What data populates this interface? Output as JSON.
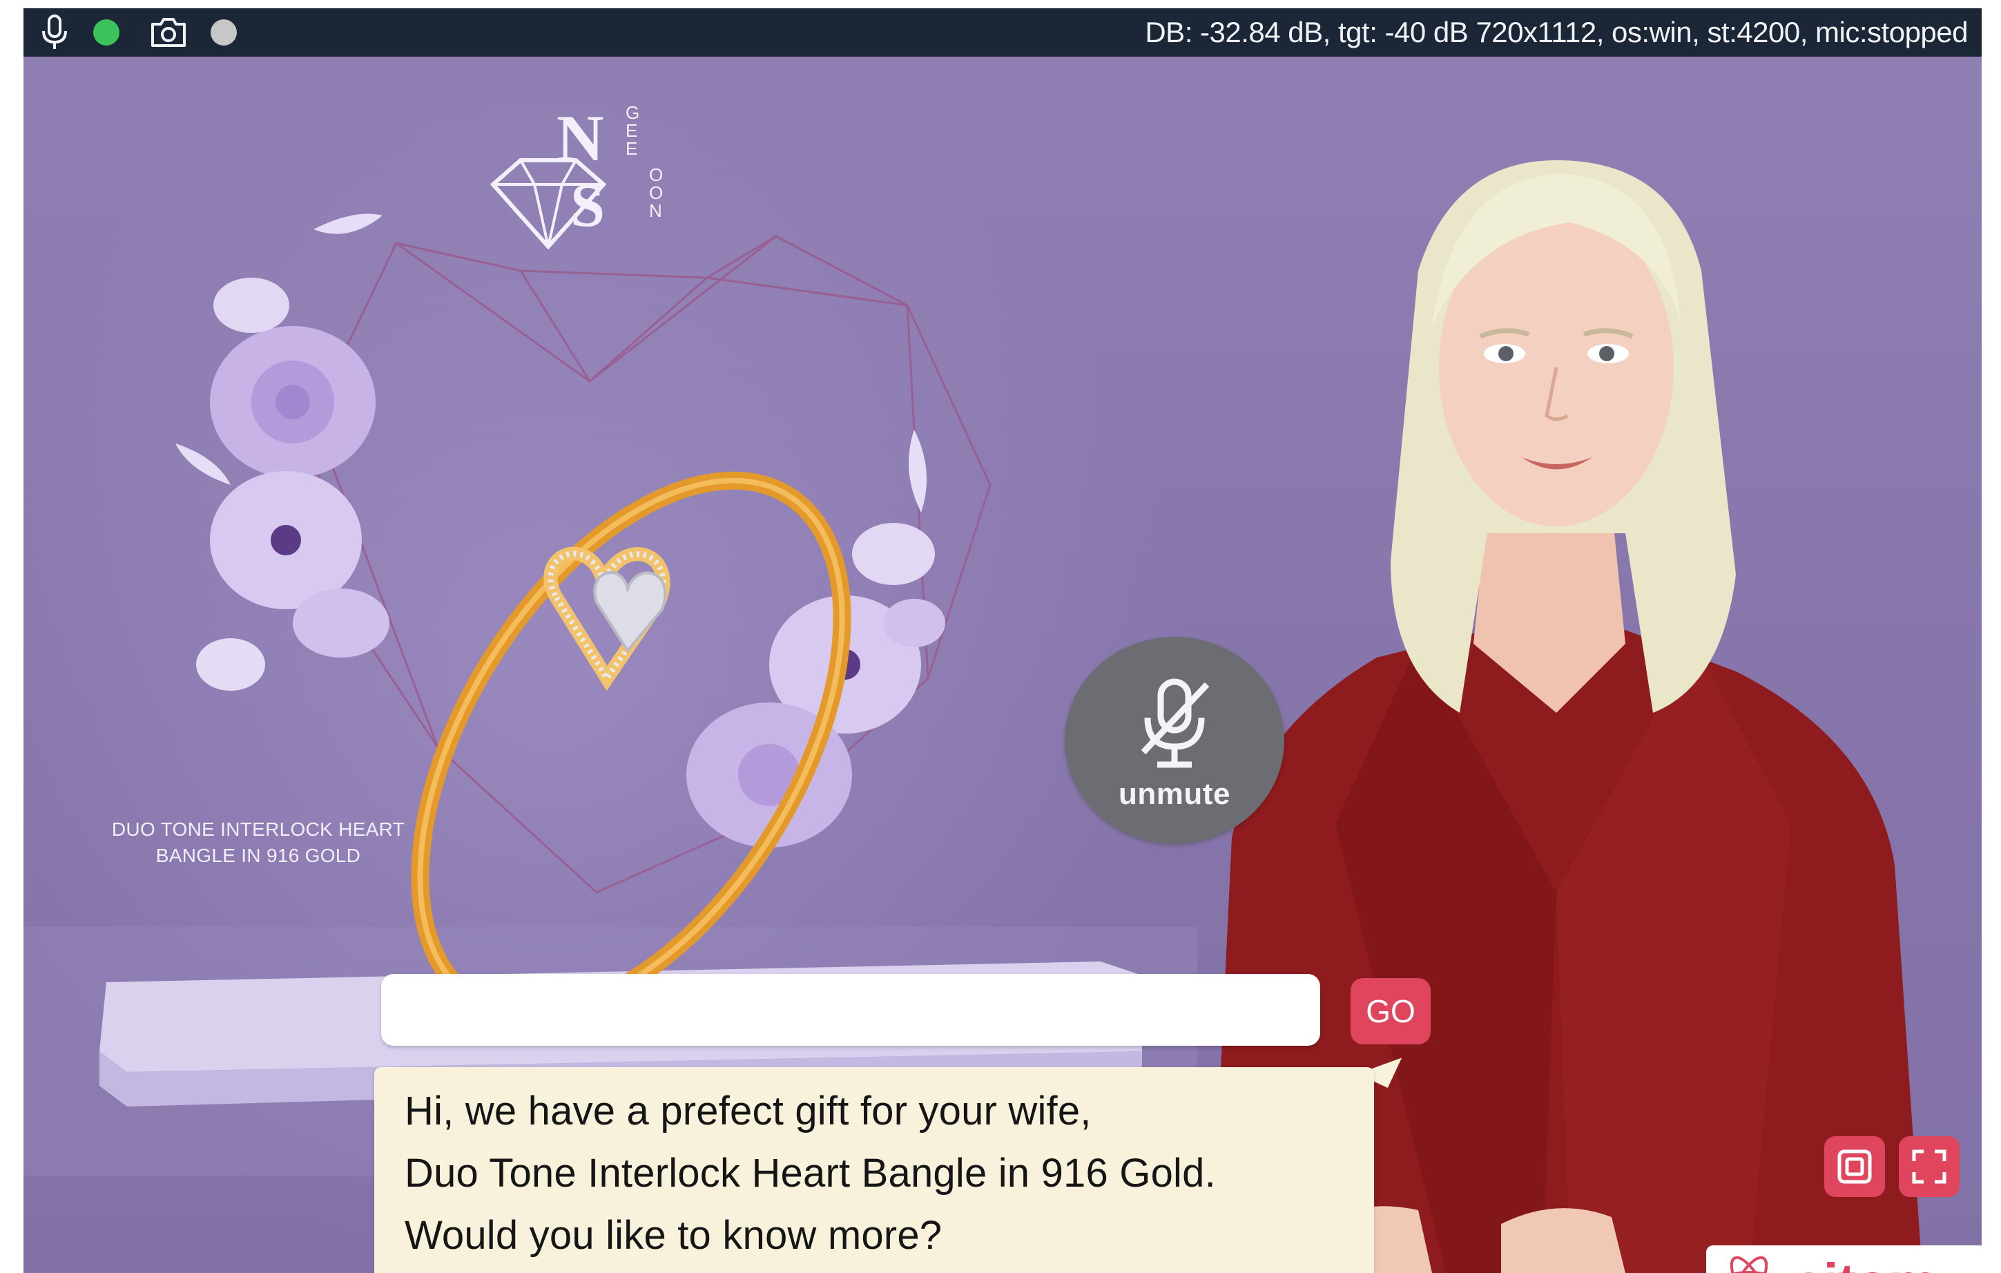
{
  "status_bar": {
    "icons": {
      "mic": "mic-icon",
      "mic_status_color": "#3cc25a",
      "camera": "camera-icon",
      "camera_status_color": "#c7c7c7"
    },
    "status_text": "DB: -32.84 dB, tgt: -40 dB  720x1112, os:win, st:4200, mic:stopped"
  },
  "product": {
    "brand_logo": "NGEE SOON",
    "caption_line1": "DUO TONE INTERLOCK HEART",
    "caption_line2": "BANGLE IN 916 GOLD"
  },
  "avatar": {
    "unmute_label": "unmute",
    "unmute_icon": "mic-off-icon"
  },
  "chat": {
    "input_value": "",
    "go_label": "GO"
  },
  "speech": {
    "line1": "Hi, we have a prefect gift for your wife,",
    "line2": "Duo Tone Interlock Heart Bangle in 916 Gold.",
    "line3": "Would you like to know more?"
  },
  "controls": {
    "picture_in_picture_icon": "picture-in-picture-icon",
    "fullscreen_icon": "fullscreen-icon"
  },
  "brand": {
    "name": "aitom",
    "logo_icon": "atom-icon"
  },
  "colors": {
    "accent": "#e0455e",
    "background": "#8978ac",
    "topbar": "#1b2637",
    "bubble": "#f8f2dc"
  }
}
